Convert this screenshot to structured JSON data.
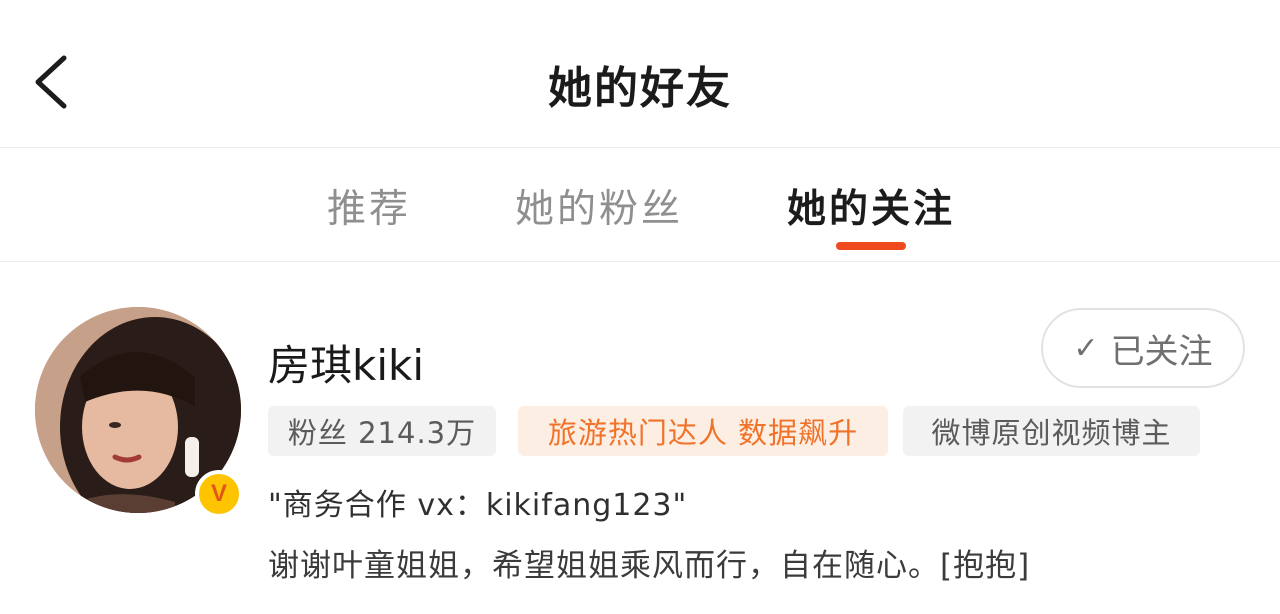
{
  "header": {
    "title": "她的好友",
    "back_icon": "chevron-left-icon"
  },
  "tabs": [
    {
      "label": "推荐",
      "active": false
    },
    {
      "label": "她的粉丝",
      "active": false
    },
    {
      "label": "她的关注",
      "active": true
    }
  ],
  "colors": {
    "accent": "#ef4a1e",
    "tag_orange_text": "#f0732a",
    "tag_orange_bg": "#fdeee4",
    "tag_grey_bg": "#f2f2f2",
    "verified_badge": "#ffc400"
  },
  "user": {
    "name": "房琪kiki",
    "verified_badge": "V",
    "follow_button": {
      "label": "已关注",
      "icon": "checkmark-icon"
    },
    "tags": [
      {
        "label": "粉丝 214.3万",
        "style": "grey"
      },
      {
        "label": "旅游热门达人 数据飙升",
        "style": "orange"
      },
      {
        "label": "微博原创视频博主",
        "style": "grey"
      }
    ],
    "description": "\"商务合作 vx：kikifang123\"",
    "bio": "谢谢叶童姐姐，希望姐姐乘风而行，自在随心。[抱抱]"
  }
}
